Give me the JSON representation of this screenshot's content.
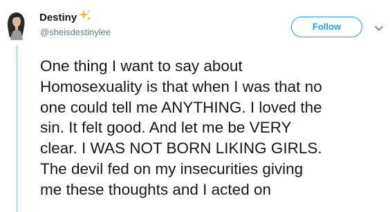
{
  "author": {
    "display_name": "Destiny",
    "handle": "@sheisdestinylee",
    "name_emoji_icon": "sparkles-icon",
    "avatar_icon": "avatar-photo"
  },
  "actions": {
    "follow_label": "Follow",
    "more_icon": "chevron-down-icon"
  },
  "tweet": {
    "lines": [
      "One thing I want to say about",
      "Homosexuality is that when I was that no",
      "one could tell me ANYTHING. I loved the",
      "sin. It felt good. And let me be VERY",
      "clear. I WAS NOT BORN LIKING GIRLS.",
      "The devil fed on my insecurities giving",
      "me these thoughts and I acted on"
    ]
  },
  "colors": {
    "accent": "#1da1f2",
    "text": "#14171a",
    "secondary_text": "#657786",
    "thread_line": "#c4e3f6",
    "emoji": "#f5b82e"
  }
}
